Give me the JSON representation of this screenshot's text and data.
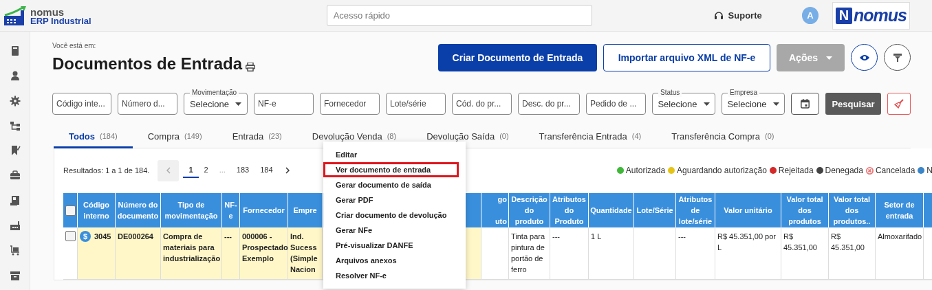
{
  "topbar": {
    "logo": {
      "line1": "nomus",
      "line2": "ERP Industrial"
    },
    "quick_access": {
      "placeholder": "Acesso rápido"
    },
    "support": "Suporte",
    "avatar": "A",
    "brand": {
      "mark": "N",
      "name": "nomus"
    }
  },
  "breadcrumb": "Você está em:",
  "title": "Documentos de Entrada",
  "actions": [
    {
      "label": "Criar Documento de Entrada",
      "kind": "primary",
      "disabled": false
    },
    {
      "label": "Importar arquivo XML de NF-e",
      "kind": "outline",
      "disabled": false
    },
    {
      "label": "Ações",
      "kind": "dropdown",
      "disabled": true
    }
  ],
  "filters": [
    {
      "kind": "text",
      "placeholder": "Código inte..."
    },
    {
      "kind": "text",
      "placeholder": "Número d..."
    },
    {
      "kind": "select",
      "label": "Movimentação",
      "value": "Selecione"
    },
    {
      "kind": "text",
      "placeholder": "NF-e"
    },
    {
      "kind": "text",
      "placeholder": "Fornecedor"
    },
    {
      "kind": "text",
      "placeholder": "Lote/série"
    },
    {
      "kind": "text",
      "placeholder": "Cód. do pr..."
    },
    {
      "kind": "text",
      "placeholder": "Desc. do pr..."
    },
    {
      "kind": "text",
      "placeholder": "Pedido de ..."
    },
    {
      "kind": "select",
      "label": "Status",
      "value": "Selecione"
    },
    {
      "kind": "select",
      "label": "Empresa",
      "value": "Selecione"
    }
  ],
  "search_button": "Pesquisar",
  "tabs": [
    {
      "label": "Todos",
      "count": "(184)",
      "selected": true
    },
    {
      "label": "Compra",
      "count": "(149)",
      "selected": false
    },
    {
      "label": "Entrada",
      "count": "(23)",
      "selected": false
    },
    {
      "label": "Devolução Venda",
      "count": "(8)",
      "selected": false
    },
    {
      "label": "Devolução Saída",
      "count": "(0)",
      "selected": false
    },
    {
      "label": "Transferência Entrada",
      "count": "(4)",
      "selected": false
    },
    {
      "label": "Transferência Compra",
      "count": "(0)",
      "selected": false
    }
  ],
  "results": "Resultados: 1 a 1 de 184.",
  "pager": [
    {
      "label": "1",
      "kind": "page",
      "selected": true
    },
    {
      "label": "2",
      "kind": "page",
      "selected": false
    },
    {
      "label": "...",
      "kind": "gap",
      "selected": false
    },
    {
      "label": "183",
      "kind": "page",
      "selected": false
    },
    {
      "label": "184",
      "kind": "page",
      "selected": false
    }
  ],
  "legend": [
    {
      "label": "Autorizada",
      "kind": "dot",
      "color": "#3fb83a"
    },
    {
      "label": "Aguardando autorização",
      "kind": "dot",
      "color": "#e6c417"
    },
    {
      "label": "Rejeitada",
      "kind": "dot",
      "color": "#d42a2a"
    },
    {
      "label": "Denegada",
      "kind": "dot",
      "color": "#444444"
    },
    {
      "label": "Cancelada",
      "kind": "cancel",
      "color": "#e87a7a"
    },
    {
      "label": "N",
      "kind": "dot",
      "color": "#3a86c8"
    }
  ],
  "table": {
    "select_all": {
      "checked": false
    },
    "columns": [
      {
        "label": "Código interno",
        "kind": "document"
      },
      {
        "label": "Número do documento",
        "kind": "document"
      },
      {
        "label": "Tipo de movimentação",
        "kind": "document"
      },
      {
        "label": "NF-e",
        "kind": "document"
      },
      {
        "label": "Fornecedor",
        "kind": "document"
      },
      {
        "label": "Empre",
        "kind": "document"
      },
      {
        "label": "go\n\nuto",
        "kind": "product"
      },
      {
        "label": "Descrição do produto",
        "kind": "product"
      },
      {
        "label": "Atributos do Produto",
        "kind": "product"
      },
      {
        "label": "Quantidade",
        "kind": "product"
      },
      {
        "label": "Lote/Série",
        "kind": "product"
      },
      {
        "label": "Atributos de lote/série",
        "kind": "product"
      },
      {
        "label": "Valor unitário",
        "kind": "product"
      },
      {
        "label": "Valor total dos produtos",
        "kind": "product"
      },
      {
        "label": "Valor total dos produtos..",
        "kind": "product"
      },
      {
        "label": "Setor de entrada",
        "kind": "product"
      }
    ],
    "rows": [
      {
        "checked": false,
        "badge": "$",
        "cells": [
          "3045",
          "DE000264",
          "Compra de materiais para industrialização",
          "---",
          "000006 - Prospectado Exemplo",
          "Ind. Sucess (Simple Nacion",
          null,
          "Tinta para pintura de portão de ferro",
          "---",
          "1 L",
          null,
          "---",
          "R$ 45.351,00 por L",
          "R$ 45.351,00",
          "R$ 45.351,00",
          "Almoxarifado"
        ]
      }
    ]
  },
  "context_menu": {
    "items": [
      {
        "label": "Editar",
        "highlighted": false
      },
      {
        "label": "Ver documento de entrada",
        "highlighted": true
      },
      {
        "label": "Gerar documento de saída",
        "highlighted": false
      },
      {
        "label": "Gerar PDF",
        "highlighted": false
      },
      {
        "label": "Criar documento de devolução",
        "highlighted": false
      },
      {
        "label": "Gerar NFe",
        "highlighted": false
      },
      {
        "label": "Pré-visualizar DANFE",
        "highlighted": false
      },
      {
        "label": "Arquivos anexos",
        "highlighted": false
      },
      {
        "label": "Resolver NF-e",
        "highlighted": false
      }
    ]
  }
}
